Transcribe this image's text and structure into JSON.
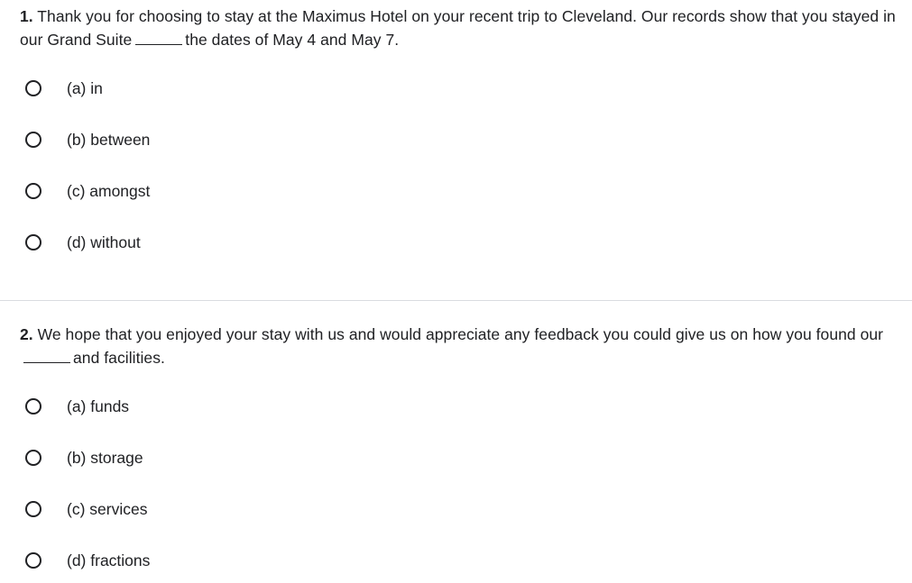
{
  "questions": [
    {
      "number": "1.",
      "text_before": " Thank you for choosing to stay at the Maximus Hotel on your recent trip to Cleveland. Our records show that you stayed in our Grand Suite",
      "text_after": "the dates of May 4 and May 7.",
      "options": [
        "(a) in",
        "(b) between",
        "(c) amongst",
        "(d) without"
      ]
    },
    {
      "number": "2.",
      "text_before": " We hope that you enjoyed your stay with us and would appreciate any feedback you could give us on how you found our",
      "text_after": "and facilities.",
      "options": [
        "(a) funds",
        "(b) storage",
        "(c) services",
        "(d) fractions"
      ]
    }
  ]
}
